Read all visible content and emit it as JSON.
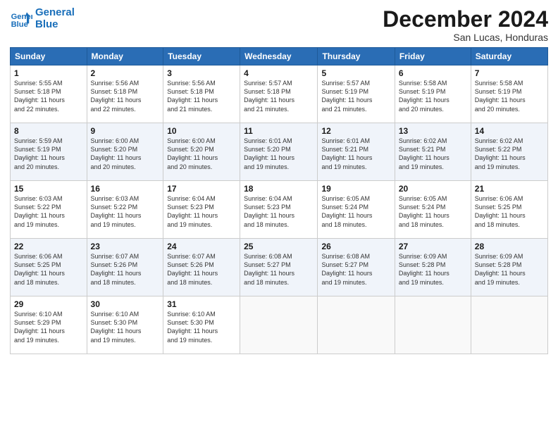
{
  "logo": {
    "line1": "General",
    "line2": "Blue"
  },
  "header": {
    "month": "December 2024",
    "location": "San Lucas, Honduras"
  },
  "weekdays": [
    "Sunday",
    "Monday",
    "Tuesday",
    "Wednesday",
    "Thursday",
    "Friday",
    "Saturday"
  ],
  "weeks": [
    [
      {
        "day": "1",
        "info": "Sunrise: 5:55 AM\nSunset: 5:18 PM\nDaylight: 11 hours\nand 22 minutes."
      },
      {
        "day": "2",
        "info": "Sunrise: 5:56 AM\nSunset: 5:18 PM\nDaylight: 11 hours\nand 22 minutes."
      },
      {
        "day": "3",
        "info": "Sunrise: 5:56 AM\nSunset: 5:18 PM\nDaylight: 11 hours\nand 21 minutes."
      },
      {
        "day": "4",
        "info": "Sunrise: 5:57 AM\nSunset: 5:18 PM\nDaylight: 11 hours\nand 21 minutes."
      },
      {
        "day": "5",
        "info": "Sunrise: 5:57 AM\nSunset: 5:19 PM\nDaylight: 11 hours\nand 21 minutes."
      },
      {
        "day": "6",
        "info": "Sunrise: 5:58 AM\nSunset: 5:19 PM\nDaylight: 11 hours\nand 20 minutes."
      },
      {
        "day": "7",
        "info": "Sunrise: 5:58 AM\nSunset: 5:19 PM\nDaylight: 11 hours\nand 20 minutes."
      }
    ],
    [
      {
        "day": "8",
        "info": "Sunrise: 5:59 AM\nSunset: 5:19 PM\nDaylight: 11 hours\nand 20 minutes."
      },
      {
        "day": "9",
        "info": "Sunrise: 6:00 AM\nSunset: 5:20 PM\nDaylight: 11 hours\nand 20 minutes."
      },
      {
        "day": "10",
        "info": "Sunrise: 6:00 AM\nSunset: 5:20 PM\nDaylight: 11 hours\nand 20 minutes."
      },
      {
        "day": "11",
        "info": "Sunrise: 6:01 AM\nSunset: 5:20 PM\nDaylight: 11 hours\nand 19 minutes."
      },
      {
        "day": "12",
        "info": "Sunrise: 6:01 AM\nSunset: 5:21 PM\nDaylight: 11 hours\nand 19 minutes."
      },
      {
        "day": "13",
        "info": "Sunrise: 6:02 AM\nSunset: 5:21 PM\nDaylight: 11 hours\nand 19 minutes."
      },
      {
        "day": "14",
        "info": "Sunrise: 6:02 AM\nSunset: 5:22 PM\nDaylight: 11 hours\nand 19 minutes."
      }
    ],
    [
      {
        "day": "15",
        "info": "Sunrise: 6:03 AM\nSunset: 5:22 PM\nDaylight: 11 hours\nand 19 minutes."
      },
      {
        "day": "16",
        "info": "Sunrise: 6:03 AM\nSunset: 5:22 PM\nDaylight: 11 hours\nand 19 minutes."
      },
      {
        "day": "17",
        "info": "Sunrise: 6:04 AM\nSunset: 5:23 PM\nDaylight: 11 hours\nand 19 minutes."
      },
      {
        "day": "18",
        "info": "Sunrise: 6:04 AM\nSunset: 5:23 PM\nDaylight: 11 hours\nand 18 minutes."
      },
      {
        "day": "19",
        "info": "Sunrise: 6:05 AM\nSunset: 5:24 PM\nDaylight: 11 hours\nand 18 minutes."
      },
      {
        "day": "20",
        "info": "Sunrise: 6:05 AM\nSunset: 5:24 PM\nDaylight: 11 hours\nand 18 minutes."
      },
      {
        "day": "21",
        "info": "Sunrise: 6:06 AM\nSunset: 5:25 PM\nDaylight: 11 hours\nand 18 minutes."
      }
    ],
    [
      {
        "day": "22",
        "info": "Sunrise: 6:06 AM\nSunset: 5:25 PM\nDaylight: 11 hours\nand 18 minutes."
      },
      {
        "day": "23",
        "info": "Sunrise: 6:07 AM\nSunset: 5:26 PM\nDaylight: 11 hours\nand 18 minutes."
      },
      {
        "day": "24",
        "info": "Sunrise: 6:07 AM\nSunset: 5:26 PM\nDaylight: 11 hours\nand 18 minutes."
      },
      {
        "day": "25",
        "info": "Sunrise: 6:08 AM\nSunset: 5:27 PM\nDaylight: 11 hours\nand 18 minutes."
      },
      {
        "day": "26",
        "info": "Sunrise: 6:08 AM\nSunset: 5:27 PM\nDaylight: 11 hours\nand 19 minutes."
      },
      {
        "day": "27",
        "info": "Sunrise: 6:09 AM\nSunset: 5:28 PM\nDaylight: 11 hours\nand 19 minutes."
      },
      {
        "day": "28",
        "info": "Sunrise: 6:09 AM\nSunset: 5:28 PM\nDaylight: 11 hours\nand 19 minutes."
      }
    ],
    [
      {
        "day": "29",
        "info": "Sunrise: 6:10 AM\nSunset: 5:29 PM\nDaylight: 11 hours\nand 19 minutes."
      },
      {
        "day": "30",
        "info": "Sunrise: 6:10 AM\nSunset: 5:30 PM\nDaylight: 11 hours\nand 19 minutes."
      },
      {
        "day": "31",
        "info": "Sunrise: 6:10 AM\nSunset: 5:30 PM\nDaylight: 11 hours\nand 19 minutes."
      },
      {
        "day": "",
        "info": ""
      },
      {
        "day": "",
        "info": ""
      },
      {
        "day": "",
        "info": ""
      },
      {
        "day": "",
        "info": ""
      }
    ]
  ]
}
